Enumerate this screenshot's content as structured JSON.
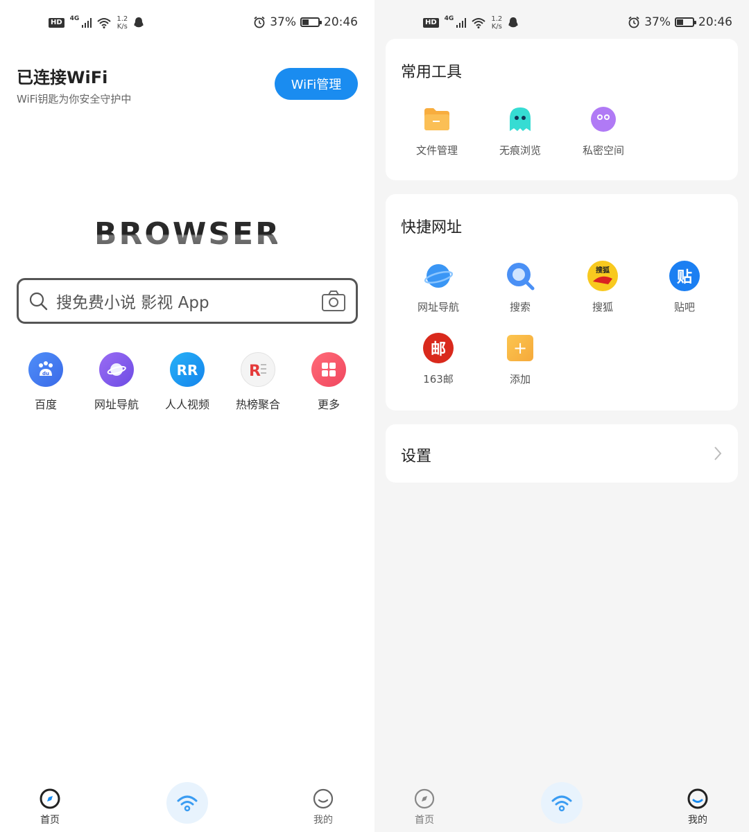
{
  "status_bar": {
    "hd": "HD",
    "network": "4G",
    "speed_value": "1.2",
    "speed_unit": "K/s",
    "battery": "37%",
    "battery_level": 0.37,
    "time": "20:46"
  },
  "home": {
    "wifi_title": "已连接WiFi",
    "wifi_subtitle": "WiFi钥匙为你安全守护中",
    "wifi_button": "WiFi管理",
    "logo_text": "BROWSER",
    "search_placeholder": "搜免费小说 影视 App",
    "quick_links": [
      {
        "label": "百度",
        "icon": "baidu-icon",
        "color": "#3f7cf3"
      },
      {
        "label": "网址导航",
        "icon": "planet-icon",
        "color": "#8c5cf0"
      },
      {
        "label": "人人视频",
        "icon": "rr-icon",
        "color": "#1d9df5"
      },
      {
        "label": "热榜聚合",
        "icon": "hot-list-icon",
        "color": "#e43b3b"
      },
      {
        "label": "更多",
        "icon": "grid-icon",
        "color": "#f6546a"
      }
    ]
  },
  "tools": {
    "title": "常用工具",
    "items": [
      {
        "label": "文件管理",
        "icon": "folder-icon",
        "color": "#f7a73a"
      },
      {
        "label": "无痕浏览",
        "icon": "ghost-icon",
        "color": "#2fd6cf"
      },
      {
        "label": "私密空间",
        "icon": "mask-icon",
        "color": "#a86ff2"
      }
    ]
  },
  "shortcuts": {
    "title": "快捷网址",
    "items": [
      {
        "label": "网址导航",
        "icon": "planet-icon",
        "color": "#2e8df3"
      },
      {
        "label": "搜索",
        "icon": "search-q-icon",
        "color": "#4a90f5"
      },
      {
        "label": "搜狐",
        "icon": "sohu-icon",
        "color": "#f6c31f",
        "badge": "搜狐"
      },
      {
        "label": "贴吧",
        "icon": "tieba-icon",
        "color": "#1b7ff2",
        "badge": "贴"
      },
      {
        "label": "163邮",
        "icon": "mail163-icon",
        "color": "#d9291c",
        "badge": "邮"
      },
      {
        "label": "添加",
        "icon": "add-icon",
        "color": "#f7b843",
        "badge": "+"
      }
    ]
  },
  "settings": {
    "label": "设置"
  },
  "nav": {
    "home": "首页",
    "mine": "我的"
  }
}
